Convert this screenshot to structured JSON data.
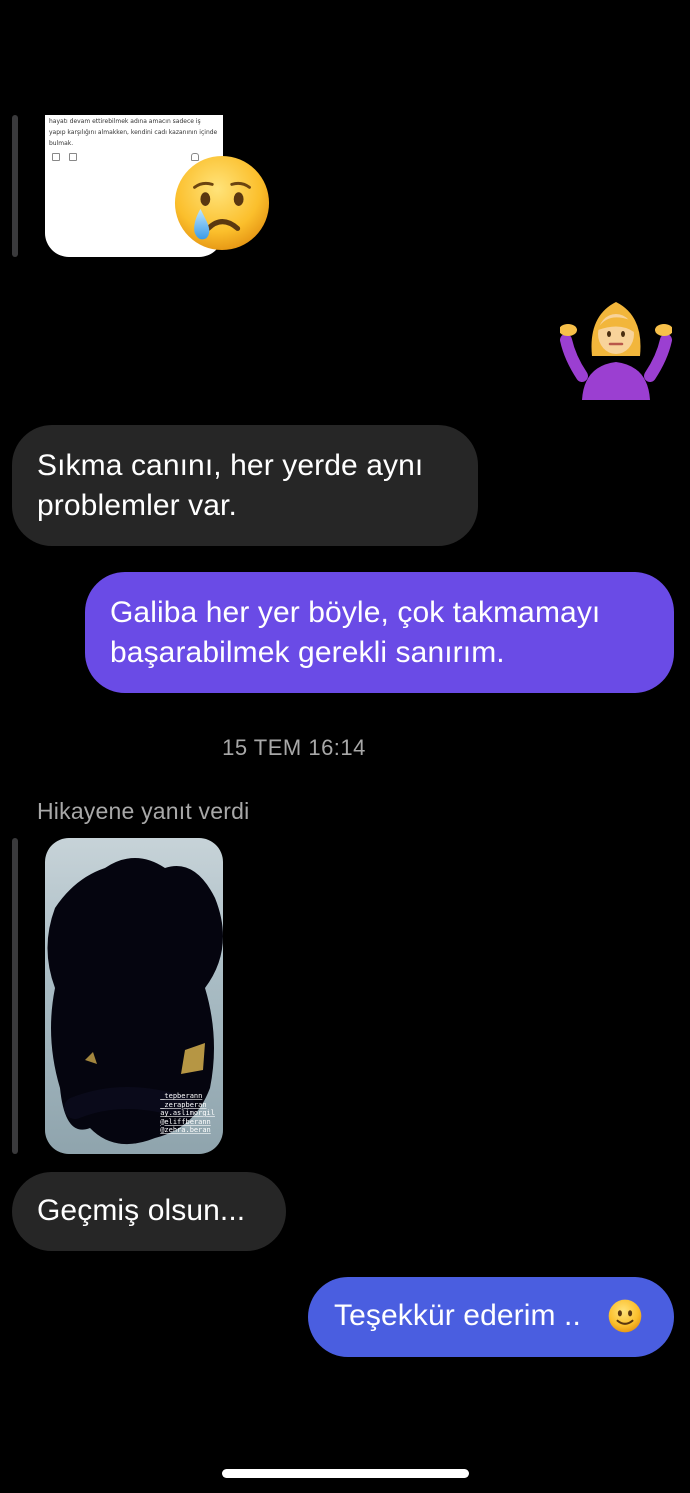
{
  "story_reply_1": {
    "snippet": "hayatı devam ettirebilmek adına amacın sadece iş yapıp karşılığını almakken, kendini cadı kazanının içinde bulmak."
  },
  "emoji": {
    "crying": "crying-face-icon",
    "shrug": "woman-shrugging-icon",
    "smile": "slightly-smiling-face-icon"
  },
  "messages": [
    {
      "side": "incoming",
      "text_line1": "Sıkma canını, her yerde aynı",
      "text_line2": "problemler var."
    },
    {
      "side": "outgoing",
      "text_line1": "Galiba her yer böyle, çok takmamayı",
      "text_line2": "başarabilmek gerekli sanırım."
    }
  ],
  "timestamp": "15 TEM 16:14",
  "story_reply_2": {
    "label": "Hikayene yanıt verdi",
    "tags": [
      "_tepberann",
      "_zerapberan",
      "ay.aslimorgil",
      "@eliffberann",
      "@zehra.beran"
    ]
  },
  "message_3": {
    "text": "Geçmiş olsun..."
  },
  "message_4": {
    "text": "Teşekkür ederim .."
  },
  "colors": {
    "background": "#000000",
    "incoming_bubble": "#262626",
    "outgoing_bubble_purple": "#6a4be6",
    "outgoing_bubble_blue": "#4a5ee0",
    "meta_text": "#a8a8a8"
  }
}
